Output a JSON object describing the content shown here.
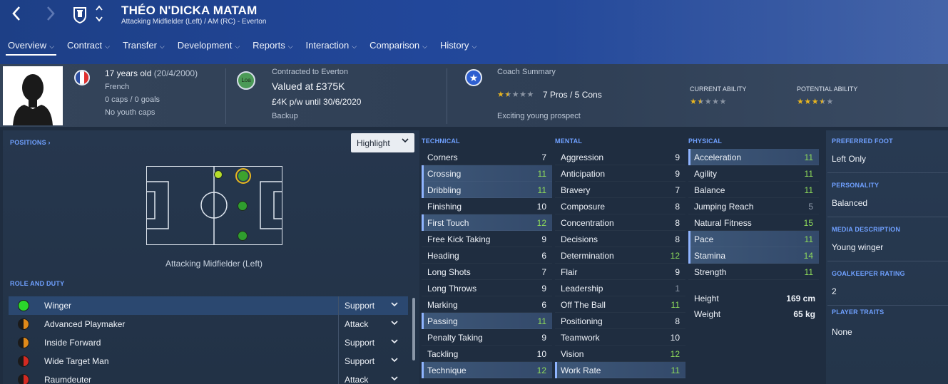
{
  "header": {
    "back_icon": "chevron-left-icon",
    "forward_icon": "chevron-right-icon",
    "player_name": "THÉO N'DICKA MATAM",
    "player_subtitle": "Attacking Midfielder (Left) / AM (RC) - Everton",
    "menu": [
      {
        "label": "Overview",
        "active": true
      },
      {
        "label": "Contract"
      },
      {
        "label": "Transfer"
      },
      {
        "label": "Development"
      },
      {
        "label": "Reports"
      },
      {
        "label": "Interaction"
      },
      {
        "label": "Comparison"
      },
      {
        "label": "History"
      }
    ]
  },
  "info": {
    "age": "17 years old",
    "dob": "(20/4/2000)",
    "nationality": "French",
    "caps": "0 caps / 0 goals",
    "youth_caps": "No youth caps",
    "loan_badge": "Loa",
    "contract_label": "Contracted to Everton",
    "valued": "Valued at £375K",
    "wage": "£4K p/w until 30/6/2020",
    "squad_status": "Backup",
    "coach_label": "Coach Summary",
    "coach_stars": 1.5,
    "pros_cons": "7 Pros / 5 Cons",
    "coach_comment": "Exciting young prospect",
    "current_ability_label": "CURRENT ABILITY",
    "current_ability_stars": 1.5,
    "potential_ability_label": "POTENTIAL ABILITY",
    "potential_ability_stars": 3.5,
    "colors": {
      "star_on": "#e8b520",
      "star_off": "#8a94a3",
      "flag_blue": "#2d4fa3",
      "flag_red": "#e0302f"
    }
  },
  "positions": {
    "label": "POSITIONS",
    "highlight_label": "Highlight",
    "caption": "Attacking Midfielder (Left)"
  },
  "roles": {
    "label": "ROLE AND DUTY",
    "items": [
      {
        "name": "Winger",
        "duty": "Support",
        "selected": true
      },
      {
        "name": "Advanced Playmaker",
        "duty": "Attack"
      },
      {
        "name": "Inside Forward",
        "duty": "Support"
      },
      {
        "name": "Wide Target Man",
        "duty": "Support"
      },
      {
        "name": "Raumdeuter",
        "duty": "Attack"
      }
    ]
  },
  "technical": {
    "label": "TECHNICAL",
    "items": [
      {
        "name": "Corners",
        "value": 7
      },
      {
        "name": "Crossing",
        "value": 11,
        "hl": true
      },
      {
        "name": "Dribbling",
        "value": 11,
        "hl": true
      },
      {
        "name": "Finishing",
        "value": 10
      },
      {
        "name": "First Touch",
        "value": 12,
        "hl": true
      },
      {
        "name": "Free Kick Taking",
        "value": 9
      },
      {
        "name": "Heading",
        "value": 6
      },
      {
        "name": "Long Shots",
        "value": 7
      },
      {
        "name": "Long Throws",
        "value": 9
      },
      {
        "name": "Marking",
        "value": 6
      },
      {
        "name": "Passing",
        "value": 11,
        "hl": true
      },
      {
        "name": "Penalty Taking",
        "value": 9
      },
      {
        "name": "Tackling",
        "value": 10
      },
      {
        "name": "Technique",
        "value": 12,
        "hl": true
      }
    ]
  },
  "mental": {
    "label": "MENTAL",
    "items": [
      {
        "name": "Aggression",
        "value": 9
      },
      {
        "name": "Anticipation",
        "value": 9
      },
      {
        "name": "Bravery",
        "value": 7
      },
      {
        "name": "Composure",
        "value": 8
      },
      {
        "name": "Concentration",
        "value": 8
      },
      {
        "name": "Decisions",
        "value": 8
      },
      {
        "name": "Determination",
        "value": 12
      },
      {
        "name": "Flair",
        "value": 9
      },
      {
        "name": "Leadership",
        "value": 1
      },
      {
        "name": "Off The Ball",
        "value": 11
      },
      {
        "name": "Positioning",
        "value": 8
      },
      {
        "name": "Teamwork",
        "value": 10
      },
      {
        "name": "Vision",
        "value": 12
      },
      {
        "name": "Work Rate",
        "value": 11,
        "hl": true
      }
    ]
  },
  "physical": {
    "label": "PHYSICAL",
    "items": [
      {
        "name": "Acceleration",
        "value": 11,
        "hl": true
      },
      {
        "name": "Agility",
        "value": 11
      },
      {
        "name": "Balance",
        "value": 11
      },
      {
        "name": "Jumping Reach",
        "value": 5
      },
      {
        "name": "Natural Fitness",
        "value": 15
      },
      {
        "name": "Pace",
        "value": 11,
        "hl": true
      },
      {
        "name": "Stamina",
        "value": 14,
        "hl": true
      },
      {
        "name": "Strength",
        "value": 11
      }
    ],
    "height_label": "Height",
    "height_value": "169 cm",
    "weight_label": "Weight",
    "weight_value": "65 kg"
  },
  "side": {
    "preferred_foot_label": "PREFERRED FOOT",
    "preferred_foot": "Left Only",
    "personality_label": "PERSONALITY",
    "personality": "Balanced",
    "media_label": "MEDIA DESCRIPTION",
    "media": "Young winger",
    "gk_label": "GOALKEEPER RATING",
    "gk": "2",
    "traits_label": "PLAYER TRAITS",
    "traits": "None"
  }
}
